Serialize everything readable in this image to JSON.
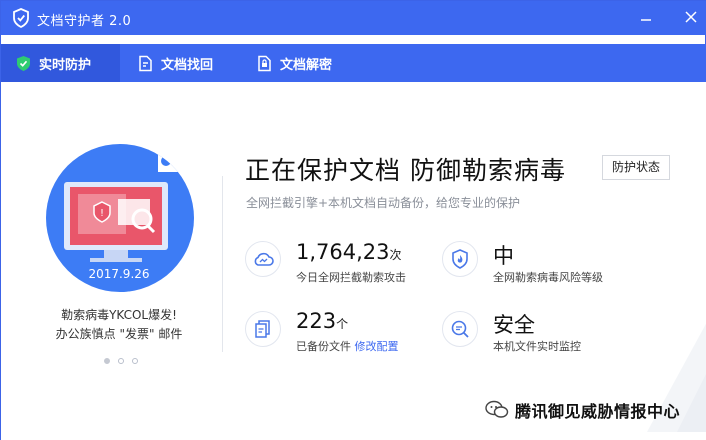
{
  "window": {
    "title": "文档守护者 2.0",
    "minimize_icon": "minimize-icon",
    "close_icon": "close-icon"
  },
  "tabs": [
    {
      "label": "实时防护",
      "icon": "shield-icon",
      "active": true
    },
    {
      "label": "文档找回",
      "icon": "document-recover-icon",
      "active": false
    },
    {
      "label": "文档解密",
      "icon": "document-decrypt-icon",
      "active": false
    }
  ],
  "news": {
    "date": "2017.9.26",
    "line1": "勒索病毒YKCOL爆发!",
    "line2": "办公族慎点 \"发票\" 邮件",
    "dots": 3,
    "active_dot": 0
  },
  "main": {
    "headline": "正在保护文档 防御勒索病毒",
    "status_button": "防护状态",
    "subtitle": "全网拦截引擎+本机文档自动备份，给您专业的保护"
  },
  "stats": {
    "intercepts": {
      "value": "1,764,23",
      "unit": "次",
      "label": "今日全网拦截勒索攻击",
      "icon": "cloud-icon"
    },
    "risk": {
      "value": "中",
      "label": "全网勒索病毒风险等级",
      "icon": "shield-flame-icon"
    },
    "backup": {
      "value": "223",
      "unit": "个",
      "label": "已备份文件",
      "link": "修改配置",
      "icon": "file-copy-icon"
    },
    "monitor": {
      "value": "安全",
      "label": "本机文件实时监控",
      "icon": "magnifier-icon"
    }
  },
  "watermark": {
    "text": "腾讯御见威胁情报中心"
  },
  "colors": {
    "brand": "#3d68f0",
    "active_tab": "#3158dd",
    "circle": "#3d7cf5",
    "icon_blue": "#4a78e8"
  }
}
